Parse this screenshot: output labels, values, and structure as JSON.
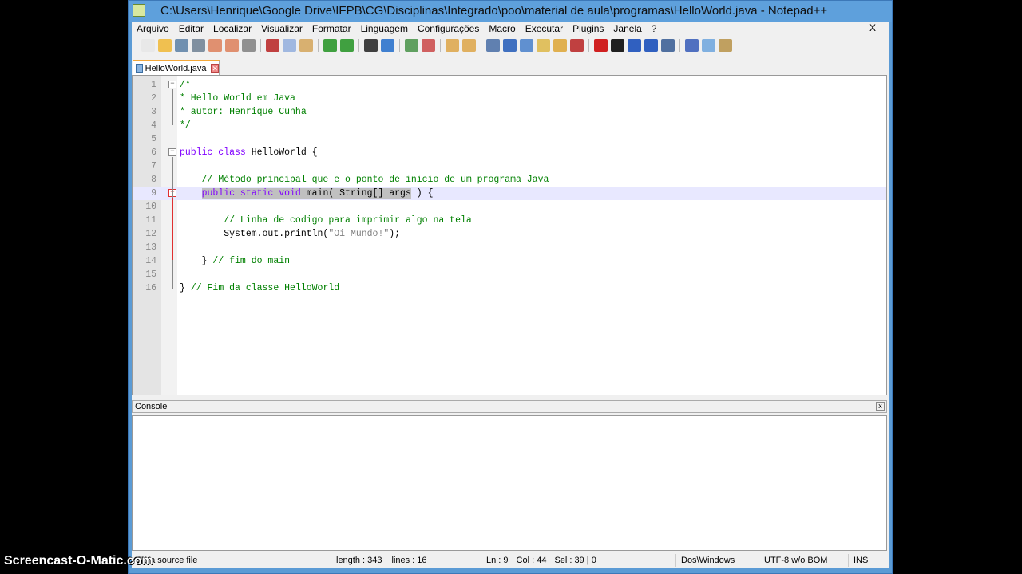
{
  "title": "C:\\Users\\Henrique\\Google Drive\\IFPB\\CG\\Disciplinas\\Integrado\\poo\\material de aula\\programas\\HelloWorld.java - Notepad++",
  "menu": [
    "Arquivo",
    "Editar",
    "Localizar",
    "Visualizar",
    "Formatar",
    "Linguagem",
    "Configurações",
    "Macro",
    "Executar",
    "Plugins",
    "Janela",
    "?"
  ],
  "menu_close": "X",
  "toolbar": [
    {
      "name": "new-icon",
      "color": "#e8e8e8"
    },
    {
      "name": "open-icon",
      "color": "#f0c050"
    },
    {
      "name": "save-icon",
      "color": "#7090b0"
    },
    {
      "name": "save-all-icon",
      "color": "#8090a0"
    },
    {
      "name": "close-icon",
      "color": "#e09070"
    },
    {
      "name": "close-all-icon",
      "color": "#e09070"
    },
    {
      "name": "print-icon",
      "color": "#909090"
    },
    {
      "sep": true
    },
    {
      "name": "cut-icon",
      "color": "#c04040"
    },
    {
      "name": "copy-icon",
      "color": "#a0b8e0"
    },
    {
      "name": "paste-icon",
      "color": "#d8b070"
    },
    {
      "sep": true
    },
    {
      "name": "undo-icon",
      "color": "#40a040"
    },
    {
      "name": "redo-icon",
      "color": "#40a040"
    },
    {
      "sep": true
    },
    {
      "name": "find-icon",
      "color": "#404040"
    },
    {
      "name": "replace-icon",
      "color": "#4080d0"
    },
    {
      "sep": true
    },
    {
      "name": "zoom-in-icon",
      "color": "#60a060"
    },
    {
      "name": "zoom-out-icon",
      "color": "#d06060"
    },
    {
      "sep": true
    },
    {
      "name": "sync-v-icon",
      "color": "#e0b060"
    },
    {
      "name": "sync-h-icon",
      "color": "#e0b060"
    },
    {
      "sep": true
    },
    {
      "name": "word-wrap-icon",
      "color": "#6080b0"
    },
    {
      "name": "show-all-chars-icon",
      "color": "#4070c0"
    },
    {
      "name": "indent-guide-icon",
      "color": "#6090d0"
    },
    {
      "name": "folder-icon",
      "color": "#e0c060"
    },
    {
      "name": "doc-map-icon",
      "color": "#e0b050"
    },
    {
      "name": "function-list-icon",
      "color": "#c04040"
    },
    {
      "sep": true
    },
    {
      "name": "record-macro-icon",
      "color": "#d02020"
    },
    {
      "name": "stop-macro-icon",
      "color": "#202020"
    },
    {
      "name": "play-macro-icon",
      "color": "#3060c0"
    },
    {
      "name": "play-multiple-icon",
      "color": "#3060c0"
    },
    {
      "name": "save-macro-icon",
      "color": "#5070a0"
    },
    {
      "sep": true
    },
    {
      "name": "spellcheck-icon",
      "color": "#5070c0"
    },
    {
      "name": "console-icon",
      "color": "#80b0e0"
    },
    {
      "name": "plugin-icon",
      "color": "#c0a060"
    }
  ],
  "tab": {
    "label": "HelloWorld.java",
    "close": "✕"
  },
  "lines": [
    {
      "n": "1",
      "fold": "−",
      "parts": [
        {
          "c": "cm",
          "t": "/*"
        }
      ]
    },
    {
      "n": "2",
      "parts": [
        {
          "c": "cm",
          "t": "* Hello World em Java"
        }
      ]
    },
    {
      "n": "3",
      "parts": [
        {
          "c": "cm",
          "t": "* autor: Henrique Cunha"
        }
      ]
    },
    {
      "n": "4",
      "parts": [
        {
          "c": "cm",
          "t": "*/"
        }
      ]
    },
    {
      "n": "5",
      "parts": []
    },
    {
      "n": "6",
      "fold": "−",
      "parts": [
        {
          "c": "kw",
          "t": "public class "
        },
        {
          "c": "tx",
          "t": "HelloWorld {"
        }
      ]
    },
    {
      "n": "7",
      "parts": []
    },
    {
      "n": "8",
      "parts": [
        {
          "c": "tx",
          "t": "    "
        },
        {
          "c": "cm",
          "t": "// Método principal que e o ponto de inicio de um programa Java"
        }
      ]
    },
    {
      "n": "9",
      "fold": "−",
      "cur": true,
      "parts": [
        {
          "c": "tx",
          "t": "    "
        },
        {
          "c": "kw sel",
          "t": "public static void "
        },
        {
          "c": "tx sel",
          "t": "main"
        },
        {
          "c": "tx sel",
          "t": "( String[] args"
        },
        {
          "c": "tx",
          "t": " ) {"
        }
      ]
    },
    {
      "n": "10",
      "parts": []
    },
    {
      "n": "11",
      "parts": [
        {
          "c": "tx",
          "t": "        "
        },
        {
          "c": "cm",
          "t": "// Linha de codigo para imprimir algo na tela"
        }
      ]
    },
    {
      "n": "12",
      "parts": [
        {
          "c": "tx",
          "t": "        System.out.println("
        },
        {
          "c": "st",
          "t": "\"Oi Mundo!\""
        },
        {
          "c": "tx",
          "t": ");"
        }
      ]
    },
    {
      "n": "13",
      "parts": []
    },
    {
      "n": "14",
      "parts": [
        {
          "c": "tx",
          "t": "    } "
        },
        {
          "c": "cm",
          "t": "// fim do main"
        }
      ]
    },
    {
      "n": "15",
      "parts": []
    },
    {
      "n": "16",
      "parts": [
        {
          "c": "tx",
          "t": "} "
        },
        {
          "c": "cm",
          "t": "// Fim da classe HelloWorld"
        }
      ]
    }
  ],
  "console": {
    "title": "Console",
    "close": "x"
  },
  "status": {
    "type": "Java source file",
    "length": "length : 343",
    "lines": "lines : 16",
    "ln": "Ln : 9",
    "col": "Col : 44",
    "sel": "Sel : 39 | 0",
    "eol": "Dos\\Windows",
    "encoding": "UTF-8 w/o BOM",
    "mode": "INS"
  },
  "watermark": "Screencast-O-Matic.com"
}
